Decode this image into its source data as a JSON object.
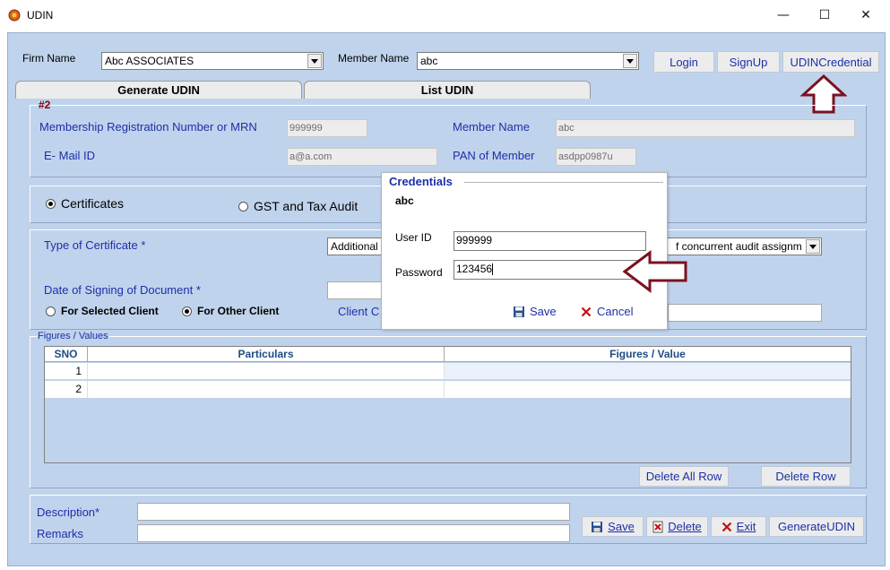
{
  "window": {
    "title": "UDIN",
    "min_glyph": "—",
    "max_glyph": "☐",
    "close_glyph": "✕"
  },
  "header": {
    "firm_label": "Firm Name",
    "firm_value": "Abc ASSOCIATES",
    "member_label": "Member Name",
    "member_value": "abc",
    "login": "Login",
    "signup": "SignUp",
    "udin_credential": "UDINCredential"
  },
  "tabs": [
    {
      "label": "Generate UDIN"
    },
    {
      "label": "List UDIN"
    }
  ],
  "member_panel": {
    "badge": "#2",
    "mrn_label": "Membership Registration Number or MRN",
    "mrn_value": "999999",
    "member_name_label": "Member Name",
    "member_name_value": "abc",
    "email_label": "E- Mail ID",
    "email_value": "a@a.com",
    "pan_label": "PAN of Member",
    "pan_value": "asdpp0987u"
  },
  "category": {
    "certificates": "Certificates",
    "gst": "GST and Tax Audit",
    "selected": "Certificates"
  },
  "document": {
    "type_label": "Type of Certificate *",
    "type_value_left": "Additional",
    "type_value_right": "f concurrent audit assignm",
    "date_label": "Date of Signing of Document *",
    "for_selected": "For Selected Client",
    "for_other": "For Other Client",
    "client_label": "Client C"
  },
  "figures": {
    "group_label": "Figures / Values",
    "columns": [
      "SNO",
      "Particulars",
      "Figures / Value"
    ],
    "rows": [
      {
        "sno": "1",
        "particulars": "",
        "value": ""
      },
      {
        "sno": "2",
        "particulars": "",
        "value": ""
      }
    ],
    "delete_all": "Delete All Row",
    "delete_row": "Delete Row"
  },
  "footer": {
    "description_label": "Description*",
    "remarks_label": "Remarks",
    "save": "Save",
    "delete": "Delete",
    "exit": "Exit",
    "generate": "GenerateUDIN"
  },
  "dialog": {
    "title": "Credentials",
    "user": "abc",
    "user_id_label": "User ID",
    "user_id_value": "999999",
    "password_label": "Password",
    "password_value": "123456",
    "save": "Save",
    "cancel": "Cancel"
  },
  "colors": {
    "panel_bg": "#c0d3ec",
    "label_blue": "#1d2fa8",
    "arrow_red": "#7a1220"
  }
}
